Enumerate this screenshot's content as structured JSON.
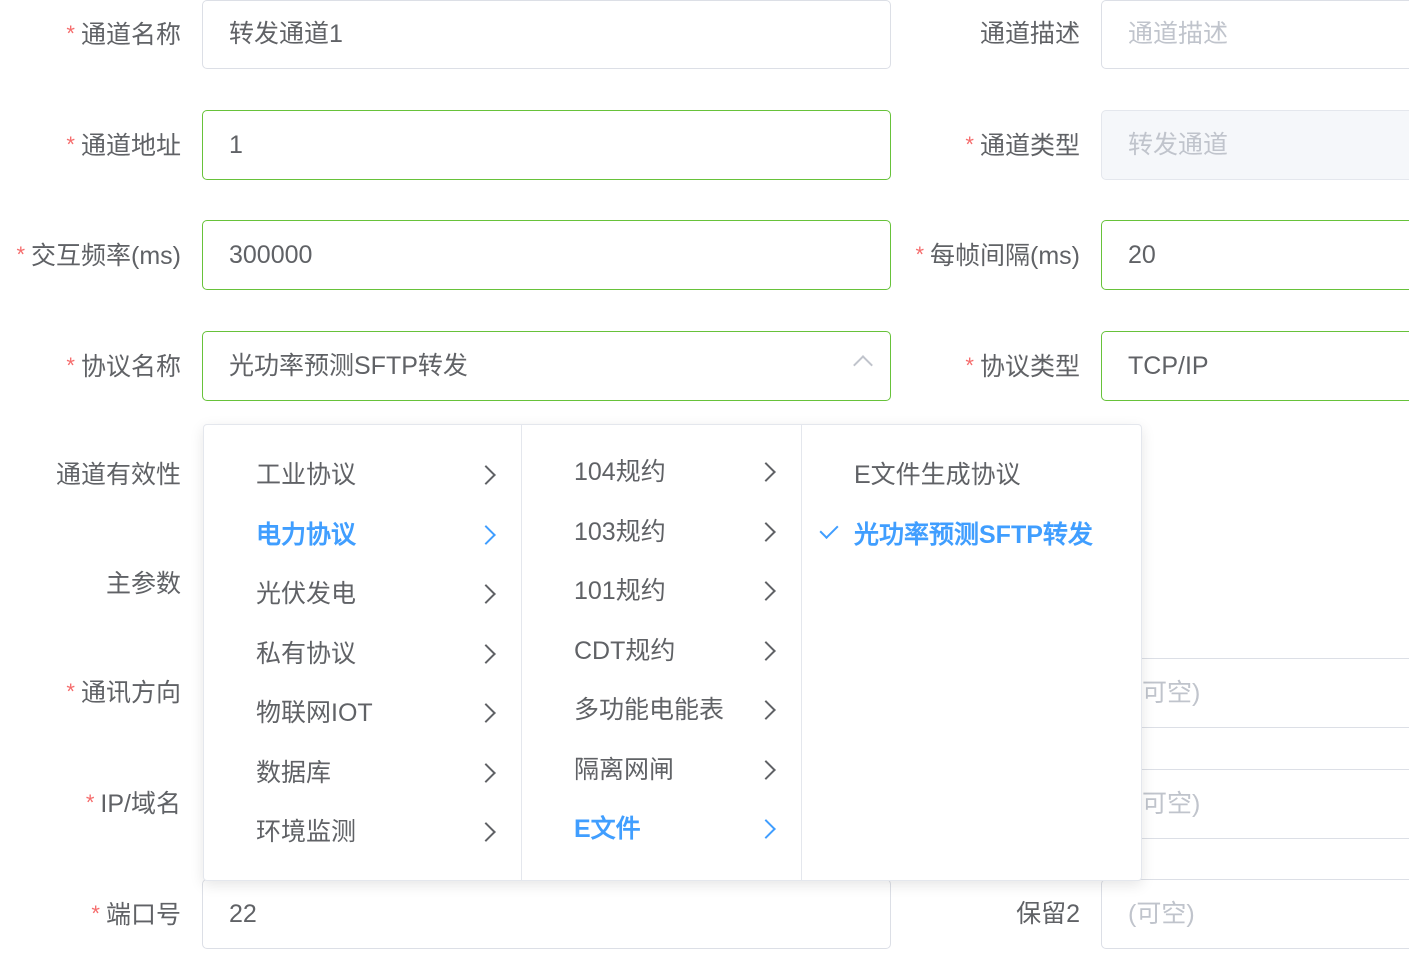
{
  "form": {
    "channel_name": {
      "label": "通道名称",
      "required": true,
      "value": "转发通道1"
    },
    "channel_desc": {
      "label": "通道描述",
      "required": false,
      "placeholder": "通道描述"
    },
    "channel_addr": {
      "label": "通道地址",
      "required": true,
      "value": "1"
    },
    "channel_type": {
      "label": "通道类型",
      "required": true,
      "value": "转发通道"
    },
    "interact_freq": {
      "label": "交互频率(ms)",
      "required": true,
      "value": "300000"
    },
    "frame_interval": {
      "label": "每帧间隔(ms)",
      "required": true,
      "value": "20"
    },
    "protocol_name": {
      "label": "协议名称",
      "required": true,
      "value": "光功率预测SFTP转发"
    },
    "protocol_type": {
      "label": "协议类型",
      "required": true,
      "value": "TCP/IP"
    },
    "channel_valid": {
      "label": "通道有效性",
      "required": false
    },
    "main_param": {
      "label": "主参数",
      "required": false
    },
    "comm_direction": {
      "label": "通讯方向",
      "required": true,
      "placeholder_partial": "可空)"
    },
    "ip_domain": {
      "label": "IP/域名",
      "required": true,
      "placeholder_partial": "可空)"
    },
    "port": {
      "label": "端口号",
      "required": true,
      "value": "22"
    },
    "reserve2": {
      "label": "保留2",
      "required": false,
      "placeholder": "(可空)"
    }
  },
  "cascader": {
    "level1": [
      "工业协议",
      "电力协议",
      "光伏发电",
      "私有协议",
      "物联网IOT",
      "数据库",
      "环境监测"
    ],
    "level1_active": "电力协议",
    "level2": [
      "104规约",
      "103规约",
      "101规约",
      "CDT规约",
      "多功能电能表",
      "隔离网闸",
      "E文件"
    ],
    "level2_active": "E文件",
    "level3": [
      "E文件生成协议",
      "光功率预测SFTP转发"
    ],
    "level3_selected": "光功率预测SFTP转发"
  },
  "colors": {
    "required_star": "#f56c6c",
    "valid_border": "#67c23a",
    "active_blue": "#409eff"
  }
}
